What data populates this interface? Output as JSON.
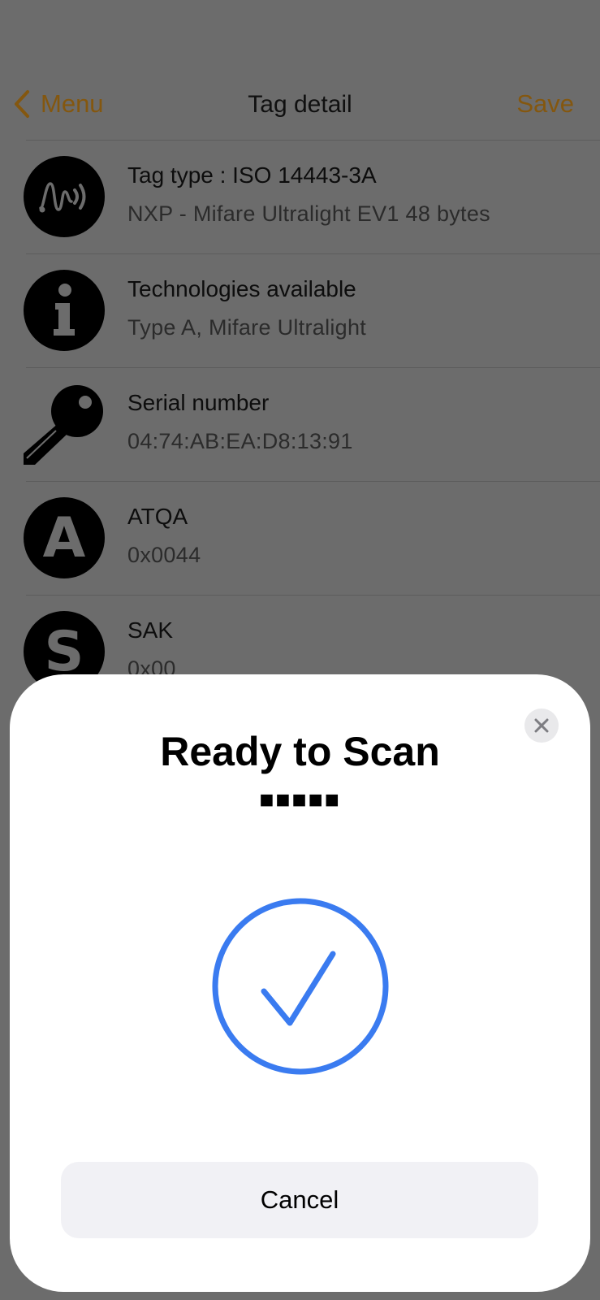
{
  "nav": {
    "back_label": "Menu",
    "title": "Tag detail",
    "save_label": "Save"
  },
  "rows": [
    {
      "icon": "nfc-wave-icon",
      "title": "Tag type : ISO 14443-3A",
      "subtitle": "NXP - Mifare Ultralight EV1 48 bytes"
    },
    {
      "icon": "info-icon",
      "title": "Technologies available",
      "subtitle": "Type A, Mifare Ultralight"
    },
    {
      "icon": "key-icon",
      "title": "Serial number",
      "subtitle": "04:74:AB:EA:D8:13:91"
    },
    {
      "icon": "letter-a-icon",
      "letter": "A",
      "title": "ATQA",
      "subtitle": "0x0044"
    },
    {
      "icon": "letter-s-icon",
      "letter": "S",
      "title": "SAK",
      "subtitle": "0x00"
    }
  ],
  "sheet": {
    "title": "Ready to Scan",
    "subtitle": "■■■■■",
    "status_icon": "checkmark-circle-icon",
    "cancel_label": "Cancel"
  },
  "colors": {
    "accent": "#84570f",
    "check_blue": "#3a7bf0",
    "dim_background": "#6c6c6c"
  }
}
